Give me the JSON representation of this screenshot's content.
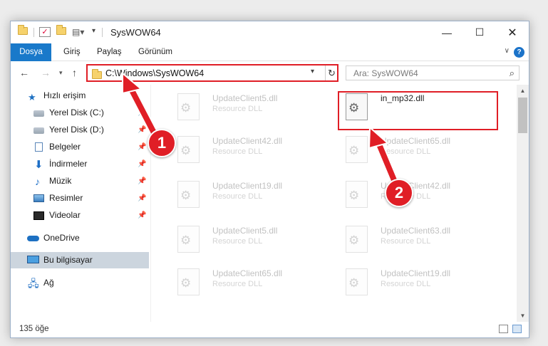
{
  "window": {
    "title": "SysWOW64"
  },
  "ribbon": {
    "tabs": [
      "Dosya",
      "Giriş",
      "Paylaş",
      "Görünüm"
    ]
  },
  "address": {
    "path": "C:\\Windows\\SysWOW64"
  },
  "search": {
    "placeholder": "Ara: SysWOW64"
  },
  "sidebar": {
    "items": [
      {
        "label": "Hızlı erişim",
        "icon": "star-icon"
      },
      {
        "label": "Yerel Disk (C:)",
        "icon": "drive-icon"
      },
      {
        "label": "Yerel Disk (D:)",
        "icon": "drive-icon"
      },
      {
        "label": "Belgeler",
        "icon": "document-icon"
      },
      {
        "label": "İndirmeler",
        "icon": "download-icon"
      },
      {
        "label": "Müzik",
        "icon": "music-icon"
      },
      {
        "label": "Resimler",
        "icon": "pictures-icon"
      },
      {
        "label": "Videolar",
        "icon": "video-icon"
      },
      {
        "label": "OneDrive",
        "icon": "cloud-icon"
      },
      {
        "label": "Bu bilgisayar",
        "icon": "computer-icon"
      },
      {
        "label": "Ağ",
        "icon": "network-icon"
      }
    ]
  },
  "files": [
    {
      "name": "UpdateClient5.dll",
      "type": "Resource DLL"
    },
    {
      "name": "in_mp32.dll",
      "type": ""
    },
    {
      "name": "UpdateClient42.dll",
      "type": "Resource DLL"
    },
    {
      "name": "UpdateClient65.dll",
      "type": "Resource DLL"
    },
    {
      "name": "UpdateClient19.dll",
      "type": "Resource DLL"
    },
    {
      "name": "UpdateClient42.dll",
      "type": "Resource DLL"
    },
    {
      "name": "UpdateClient5.dll",
      "type": "Resource DLL"
    },
    {
      "name": "UpdateClient63.dll",
      "type": "Resource DLL"
    },
    {
      "name": "UpdateClient65.dll",
      "type": "Resource DLL"
    },
    {
      "name": "UpdateClient19.dll",
      "type": "Resource DLL"
    }
  ],
  "annotations": {
    "step1": "1",
    "step2": "2",
    "color": "#e01e26"
  },
  "status": {
    "count": "135 öğe"
  }
}
